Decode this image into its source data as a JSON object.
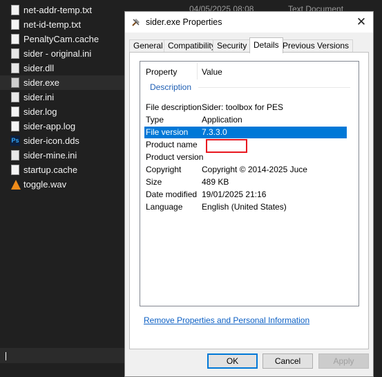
{
  "explorer": {
    "files": [
      {
        "name": "net-addr-temp.txt",
        "icon": "text-file-icon"
      },
      {
        "name": "net-id-temp.txt",
        "icon": "text-file-icon"
      },
      {
        "name": "PenaltyCam.cache",
        "icon": "file-icon"
      },
      {
        "name": "sider - original.ini",
        "icon": "settings-file-icon"
      },
      {
        "name": "sider.dll",
        "icon": "dll-file-icon"
      },
      {
        "name": "sider.exe",
        "icon": "sider-app-icon"
      },
      {
        "name": "sider.ini",
        "icon": "settings-file-icon"
      },
      {
        "name": "sider.log",
        "icon": "text-file-icon"
      },
      {
        "name": "sider-app.log",
        "icon": "text-file-icon"
      },
      {
        "name": "sider-icon.dds",
        "icon": "photoshop-file-icon"
      },
      {
        "name": "sider-mine.ini",
        "icon": "settings-file-icon"
      },
      {
        "name": "startup.cache",
        "icon": "file-icon"
      },
      {
        "name": "toggle.wav",
        "icon": "vlc-audio-icon"
      }
    ],
    "selected_file": "sider.exe",
    "partial_date": "04/05/2025 08:08",
    "partial_type": "Text Document"
  },
  "dialog": {
    "title": "sider.exe Properties",
    "close_glyph": "✕",
    "tabs": [
      "General",
      "Compatibility",
      "Security",
      "Details",
      "Previous Versions"
    ],
    "active_tab": "Details",
    "columns": {
      "property": "Property",
      "value": "Value"
    },
    "group": "Description",
    "rows": [
      {
        "name": "File description",
        "value": "Sider: toolbox for PES"
      },
      {
        "name": "Type",
        "value": "Application"
      },
      {
        "name": "File version",
        "value": "7.3.3.0"
      },
      {
        "name": "Product name",
        "value": ""
      },
      {
        "name": "Product version",
        "value": ""
      },
      {
        "name": "Copyright",
        "value": "Copyright © 2014-2025 Juce"
      },
      {
        "name": "Size",
        "value": "489 KB"
      },
      {
        "name": "Date modified",
        "value": "19/01/2025 21:16"
      },
      {
        "name": "Language",
        "value": "English (United States)"
      }
    ],
    "selected_row": "File version",
    "link": "Remove Properties and Personal Information",
    "buttons": {
      "ok": "OK",
      "cancel": "Cancel",
      "apply": "Apply"
    },
    "colors": {
      "selection": "#0078d7",
      "highlight_box": "#e8161e",
      "link": "#0b5fc4",
      "group_title": "#1e5eb3"
    }
  }
}
